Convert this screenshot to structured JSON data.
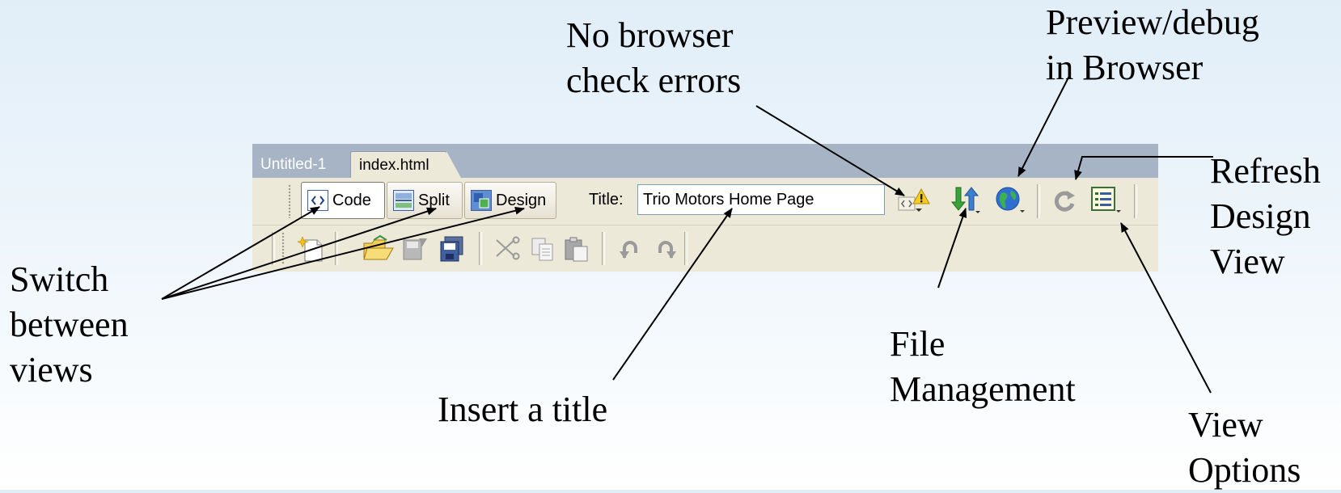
{
  "tabs": [
    {
      "label": "Untitled-1",
      "active": false
    },
    {
      "label": "index.html",
      "active": true
    }
  ],
  "views": {
    "code_label": "Code",
    "split_label": "Split",
    "design_label": "Design",
    "selected": "code"
  },
  "title_field": {
    "label": "Title:",
    "value": "Trio Motors Home Page"
  },
  "toolbar_icons": {
    "row1": [
      "browser-check-warning-icon",
      "file-management-icon",
      "preview-browser-globe-icon",
      "refresh-design-view-icon",
      "view-options-icon"
    ],
    "row2": [
      "new-document-icon",
      "open-folder-icon",
      "save-file-icon",
      "save-all-icon",
      "cut-icon",
      "copy-icon",
      "paste-icon",
      "undo-icon",
      "redo-icon"
    ]
  },
  "callouts": {
    "no_browser_check": [
      "No browser",
      "check errors"
    ],
    "preview_debug": [
      "Preview/debug",
      "in Browser"
    ],
    "refresh_design": [
      "Refresh",
      "Design",
      "View"
    ],
    "switch_views": [
      "Switch",
      "between",
      "views"
    ],
    "insert_title": [
      "Insert a title"
    ],
    "file_management": [
      "File",
      "Management"
    ],
    "view_options": [
      "View",
      "Options"
    ]
  },
  "colors": {
    "toolbar_bg": "#ece9d8",
    "tabbar_bg": "#a6b4c6",
    "page_bg_top": "#e1eef8"
  }
}
